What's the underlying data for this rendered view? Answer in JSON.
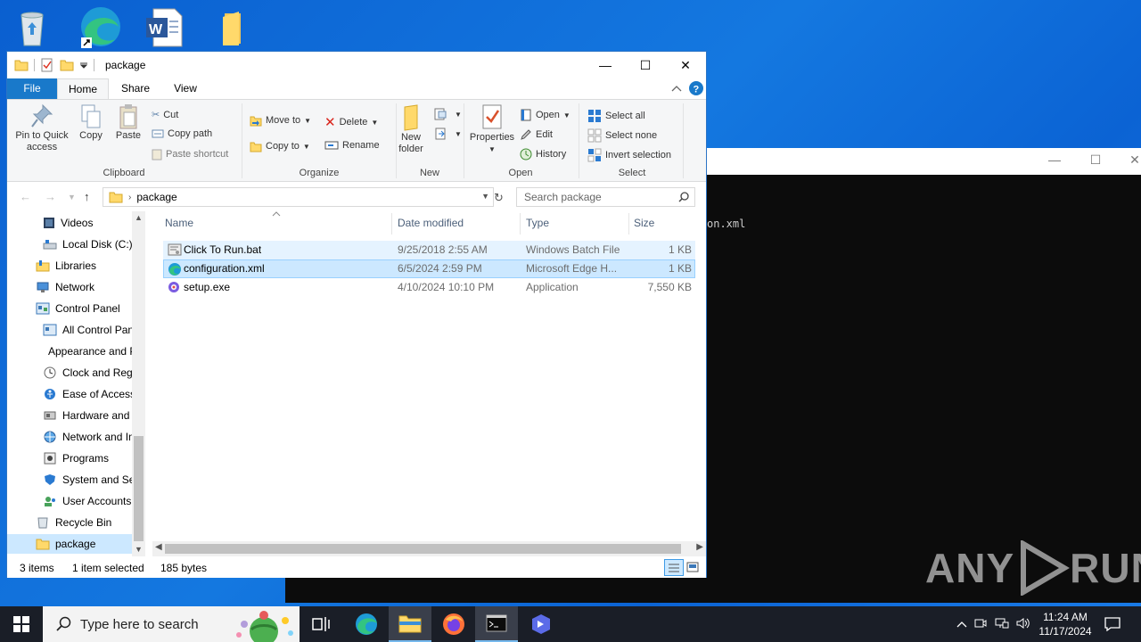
{
  "desktop": {
    "icons": [
      "recycle-bin-icon",
      "edge-shortcut-icon",
      "word-document-icon",
      "folder-icon"
    ]
  },
  "console": {
    "text": "on.xml",
    "buttons": {
      "minimize": "—",
      "maximize": "☐",
      "close": "✕"
    }
  },
  "watermark": {
    "left": "ANY",
    "right": "RUN"
  },
  "explorer": {
    "title": "package",
    "window_buttons": {
      "minimize": "—",
      "maximize": "☐",
      "close": "✕"
    },
    "tabs": {
      "file": "File",
      "home": "Home",
      "share": "Share",
      "view": "View"
    },
    "ribbon": {
      "clipboard": {
        "pin": "Pin to Quick access",
        "copy": "Copy",
        "paste": "Paste",
        "cut": "Cut",
        "copy_path": "Copy path",
        "paste_shortcut": "Paste shortcut",
        "label": "Clipboard"
      },
      "organize": {
        "move_to": "Move to",
        "copy_to": "Copy to",
        "delete": "Delete",
        "rename": "Rename",
        "label": "Organize"
      },
      "new": {
        "new_folder": "New folder",
        "label": "New"
      },
      "open": {
        "properties": "Properties",
        "open": "Open",
        "edit": "Edit",
        "history": "History",
        "label": "Open"
      },
      "select": {
        "select_all": "Select all",
        "select_none": "Select none",
        "invert_selection": "Invert selection",
        "label": "Select"
      }
    },
    "address": {
      "path": "package",
      "search_placeholder": "Search package"
    },
    "nav": [
      {
        "label": "Videos",
        "icon": "videos-icon"
      },
      {
        "label": "Local Disk (C:)",
        "icon": "drive-icon"
      },
      {
        "label": "Libraries",
        "icon": "libraries-icon"
      },
      {
        "label": "Network",
        "icon": "network-icon"
      },
      {
        "label": "Control Panel",
        "icon": "control-panel-icon"
      },
      {
        "label": "All Control Panel Items",
        "icon": "control-panel-icon"
      },
      {
        "label": "Appearance and Personalization",
        "icon": "appearance-icon"
      },
      {
        "label": "Clock and Region",
        "icon": "clock-icon"
      },
      {
        "label": "Ease of Access",
        "icon": "ease-of-access-icon"
      },
      {
        "label": "Hardware and Sound",
        "icon": "hardware-icon"
      },
      {
        "label": "Network and Internet",
        "icon": "network-internet-icon"
      },
      {
        "label": "Programs",
        "icon": "programs-icon"
      },
      {
        "label": "System and Security",
        "icon": "system-security-icon"
      },
      {
        "label": "User Accounts",
        "icon": "user-accounts-icon"
      },
      {
        "label": "Recycle Bin",
        "icon": "recycle-bin-icon"
      },
      {
        "label": "package",
        "icon": "folder-icon"
      }
    ],
    "columns": {
      "name": "Name",
      "date": "Date modified",
      "type": "Type",
      "size": "Size"
    },
    "files": [
      {
        "name": "Click To Run.bat",
        "date": "9/25/2018 2:55 AM",
        "type": "Windows Batch File",
        "size": "1 KB"
      },
      {
        "name": "configuration.xml",
        "date": "6/5/2024 2:59 PM",
        "type": "Microsoft Edge H...",
        "size": "1 KB"
      },
      {
        "name": "setup.exe",
        "date": "4/10/2024 10:10 PM",
        "type": "Application",
        "size": "7,550 KB"
      }
    ],
    "status": {
      "items": "3 items",
      "selected": "1 item selected",
      "bytes": "185 bytes"
    }
  },
  "taskbar": {
    "search_placeholder": "Type here to search",
    "time": "11:24 AM",
    "date": "11/17/2024"
  }
}
